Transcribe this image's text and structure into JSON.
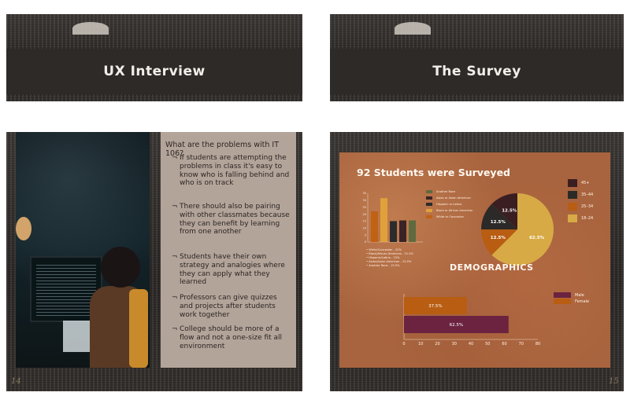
{
  "slides": {
    "ux": {
      "title": "UX Interview"
    },
    "survey": {
      "title": "The Survey"
    },
    "problems": {
      "page_number": "14",
      "question": "What are the problems with IT 106?",
      "bullet_marker": "¬",
      "bullets": [
        "If students are attempting the problems in class it's easy to know who is falling behind and who is on track",
        "There should also be pairing with other classmates because they can benefit by learning from one another",
        "Students have their own strategy and analogies where they can apply what they learned",
        "Professors can give quizzes and projects after students work together",
        "College should be more of a flow and not a one-size fit all environment"
      ]
    },
    "demographics": {
      "page_number": "15",
      "title": "92 Students were Surveyed",
      "section_title": "DEMOGRAPHICS",
      "race_legend": [
        {
          "label": "Another Race",
          "color": "#5e6b3e"
        },
        {
          "label": "Asian or Asian American",
          "color": "#3a2326"
        },
        {
          "label": "Hispanic or Latino",
          "color": "#2c2c2c"
        },
        {
          "label": "Black or African American",
          "color": "#e0a13a"
        },
        {
          "label": "White or Caucasian",
          "color": "#c06114"
        }
      ],
      "race_notes": [
        "White/Caucasian - 22%",
        "Black/African American - 31.5%",
        "Hispanic/Latino - 15%",
        "Asian/Asian American - 15.5%",
        "Another Race - 15.5%"
      ],
      "age_legend": [
        {
          "label": "45+",
          "color": "#3a1e22"
        },
        {
          "label": "35–44",
          "color": "#2c2a28"
        },
        {
          "label": "25–34",
          "color": "#b85d12"
        },
        {
          "label": "18–24",
          "color": "#d7aa45"
        }
      ],
      "gender_legend": [
        {
          "label": "Male",
          "color": "#6b2340"
        },
        {
          "label": "Female",
          "color": "#b85d12"
        }
      ]
    }
  },
  "chart_data": [
    {
      "type": "bar",
      "title": "",
      "categories": [
        "White or Caucasian",
        "Black or African American",
        "Hispanic or Latino",
        "Asian or Asian American",
        "Another Race"
      ],
      "values": [
        22,
        31.5,
        15,
        15.5,
        15.5
      ],
      "colors": [
        "#c06114",
        "#e0a13a",
        "#2c2c2c",
        "#3a2326",
        "#5e6b3e"
      ],
      "ylim": [
        0,
        35
      ],
      "yticks": [
        "35",
        "30",
        "25",
        "20",
        "15",
        "10",
        "5",
        "0"
      ]
    },
    {
      "type": "pie",
      "title": "",
      "labels": [
        "18–24",
        "25–34",
        "35–44",
        "45+"
      ],
      "values": [
        62.5,
        12.5,
        12.5,
        12.5
      ],
      "display_labels": [
        "62.5%",
        "12.5%",
        "12.5%",
        "12.5%"
      ],
      "colors": [
        "#d7aa45",
        "#b85d12",
        "#2c2a28",
        "#3a1e22"
      ]
    },
    {
      "type": "bar",
      "orientation": "horizontal",
      "title": "",
      "categories": [
        "Female",
        "Male"
      ],
      "values": [
        37.5,
        62.5
      ],
      "display_labels": [
        "37.5%",
        "62.5%"
      ],
      "colors": [
        "#b85d12",
        "#6b2340"
      ],
      "xlim": [
        0,
        80
      ],
      "xticks": [
        "0",
        "10",
        "20",
        "30",
        "40",
        "50",
        "60",
        "70",
        "80"
      ]
    }
  ]
}
